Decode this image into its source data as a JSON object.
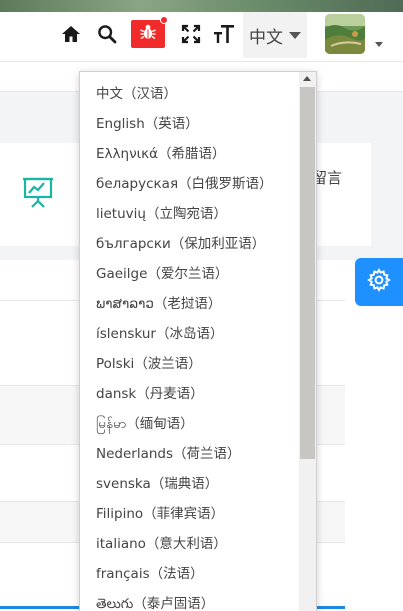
{
  "header": {
    "language_label": "中文",
    "card_text": "留言"
  },
  "language_menu": {
    "items": [
      "中文（汉语）",
      "English（英语）",
      "Ελληνικά（希腊语）",
      "беларуская（白俄罗斯语）",
      "lietuvių（立陶宛语）",
      "български（保加利亚语）",
      "Gaeilge（爱尔兰语）",
      "ພາສາລາວ（老挝语）",
      "íslenskur（冰岛语）",
      "Polski（波兰语）",
      "dansk（丹麦语）",
      "မြန်မာ（缅甸语）",
      "Nederlands（荷兰语）",
      "svenska（瑞典语）",
      "Filipino（菲律宾语）",
      "italiano（意大利语）",
      "français（法语）",
      "తెలుగు（泰卢固语）"
    ]
  },
  "icons": {
    "home": "home-icon",
    "search": "search-icon",
    "bug": "bug-icon",
    "fullscreen": "fullscreen-icon",
    "font_size": "font-size-icon",
    "settings": "gear-icon",
    "card": "presentation-chart-icon"
  },
  "colors": {
    "bug_button": "#f12b2b",
    "settings_tab": "#1e90ff",
    "card_icon": "#19b5a5"
  }
}
